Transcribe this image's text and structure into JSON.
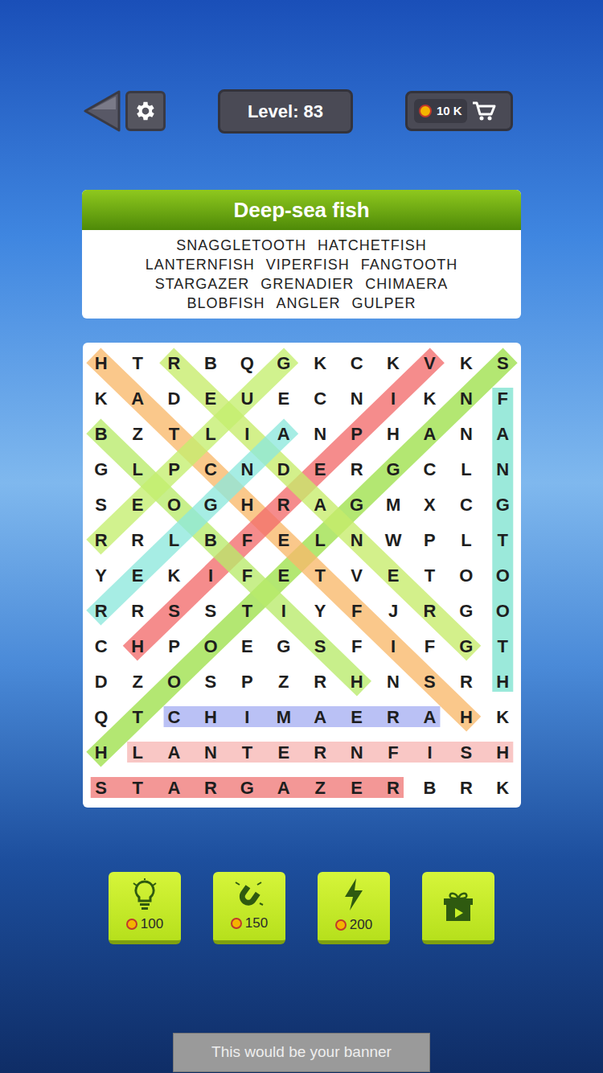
{
  "top_bar": {
    "level": "Level: 83",
    "coins": "10 K"
  },
  "header": {
    "title": "Deep-sea fish"
  },
  "words": [
    {
      "text": "SNAGGLETOOTH",
      "start": [
        0,
        11
      ],
      "end": [
        11,
        0
      ],
      "color": "#9ee04a"
    },
    {
      "text": "HATCHETFISH",
      "start": [
        0,
        0
      ],
      "end": [
        10,
        10
      ],
      "color": "#f9b86a"
    },
    {
      "text": "LANTERNFISH",
      "start": [
        11,
        1
      ],
      "end": [
        11,
        11
      ],
      "color": "#f7b7b5"
    },
    {
      "text": "VIPERFISH",
      "start": [
        0,
        9
      ],
      "end": [
        8,
        1
      ],
      "color": "#f26b6b"
    },
    {
      "text": "FANGTOOTH",
      "start": [
        1,
        11
      ],
      "end": [
        9,
        11
      ],
      "color": "#7fe3cf"
    },
    {
      "text": "STARGAZER",
      "start": [
        12,
        0
      ],
      "end": [
        12,
        8
      ],
      "color": "#f07a78"
    },
    {
      "text": "GRENADIER",
      "start": [
        8,
        10
      ],
      "end": [
        0,
        2
      ],
      "color": "#c6ec6a"
    },
    {
      "text": "CHIMAERA",
      "start": [
        10,
        2
      ],
      "end": [
        10,
        9
      ],
      "color": "#a7b0f2"
    },
    {
      "text": "BLOBFISH",
      "start": [
        2,
        0
      ],
      "end": [
        9,
        7
      ],
      "color": "#b8ea6a"
    },
    {
      "text": "ANGLER",
      "start": [
        2,
        5
      ],
      "end": [
        7,
        0
      ],
      "color": "#8de8dc"
    },
    {
      "text": "GULPER",
      "start": [
        0,
        5
      ],
      "end": [
        5,
        0
      ],
      "color": "#c4ee6e"
    }
  ],
  "grid": {
    "rows": [
      [
        "H",
        "T",
        "R",
        "B",
        "Q",
        "G",
        "K",
        "C",
        "K",
        "V",
        "K",
        "S"
      ],
      [
        "K",
        "A",
        "D",
        "E",
        "U",
        "E",
        "C",
        "N",
        "I",
        "K",
        "N",
        "F"
      ],
      [
        "B",
        "Z",
        "T",
        "L",
        "I",
        "A",
        "N",
        "P",
        "H",
        "A",
        "N",
        "A"
      ],
      [
        "G",
        "L",
        "P",
        "C",
        "N",
        "D",
        "E",
        "R",
        "G",
        "C",
        "L",
        "N"
      ],
      [
        "S",
        "E",
        "O",
        "G",
        "H",
        "R",
        "A",
        "G",
        "M",
        "X",
        "C",
        "G"
      ],
      [
        "R",
        "R",
        "L",
        "B",
        "F",
        "E",
        "L",
        "N",
        "W",
        "P",
        "L",
        "T"
      ],
      [
        "Y",
        "E",
        "K",
        "I",
        "F",
        "E",
        "T",
        "V",
        "E",
        "T",
        "O",
        "O"
      ],
      [
        "R",
        "R",
        "S",
        "S",
        "T",
        "I",
        "Y",
        "F",
        "J",
        "R",
        "G",
        "O"
      ],
      [
        "C",
        "H",
        "P",
        "O",
        "E",
        "G",
        "S",
        "F",
        "I",
        "F",
        "G",
        "T"
      ],
      [
        "D",
        "Z",
        "O",
        "S",
        "P",
        "Z",
        "R",
        "H",
        "N",
        "S",
        "R",
        "H"
      ],
      [
        "Q",
        "T",
        "C",
        "H",
        "I",
        "M",
        "A",
        "E",
        "R",
        "A",
        "H",
        "K"
      ],
      [
        "H",
        "L",
        "A",
        "N",
        "T",
        "E",
        "R",
        "N",
        "F",
        "I",
        "S",
        "H"
      ],
      [
        "S",
        "T",
        "A",
        "R",
        "G",
        "A",
        "Z",
        "E",
        "R",
        "B",
        "R",
        "K"
      ]
    ]
  },
  "tools": [
    {
      "kind": "hint",
      "price": "100"
    },
    {
      "kind": "magnet",
      "price": "150"
    },
    {
      "kind": "bolt",
      "price": "200"
    },
    {
      "kind": "video"
    }
  ],
  "banner": {
    "text": "This would be your banner"
  }
}
